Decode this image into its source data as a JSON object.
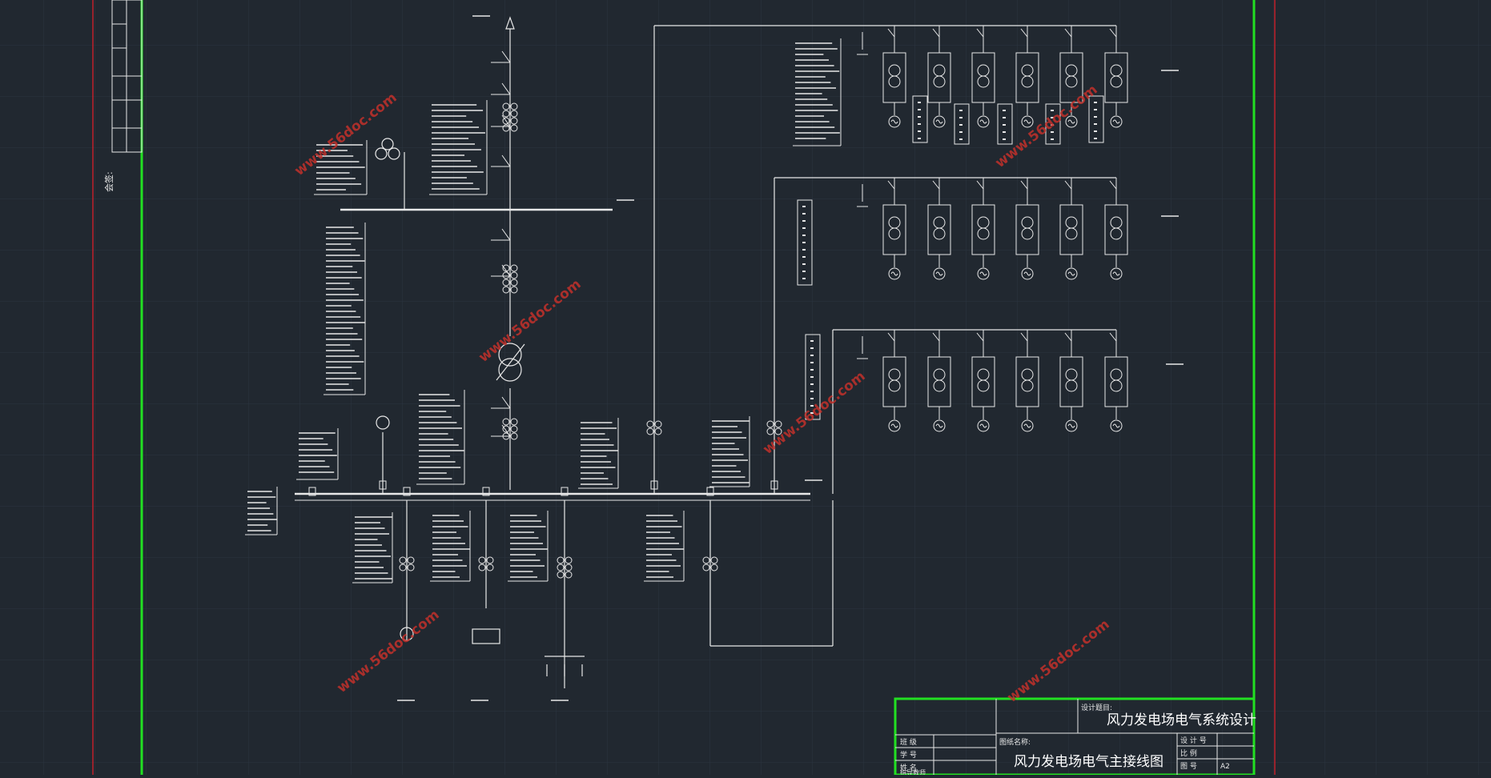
{
  "colors": {
    "background": "#212830",
    "grid": "#2c3540",
    "frame_green": "#22e022",
    "border_red": "#c0202a",
    "line_white": "#e8e8e8",
    "watermark": "#c2302a"
  },
  "title_block": {
    "project_label": "设计题目:",
    "project_title": "风力发电场电气系统设计",
    "drawing_label": "图纸名称:",
    "drawing_title": "风力发电场电气主接线图",
    "rows_left": [
      "班 级",
      "学 号",
      "姓 名",
      "指导教师"
    ],
    "rows_right": [
      "设 计 号",
      "比 例",
      "图 号"
    ],
    "sheet_size": "A2"
  },
  "watermark_text": "www.56doc.com",
  "side_label": "会签:"
}
